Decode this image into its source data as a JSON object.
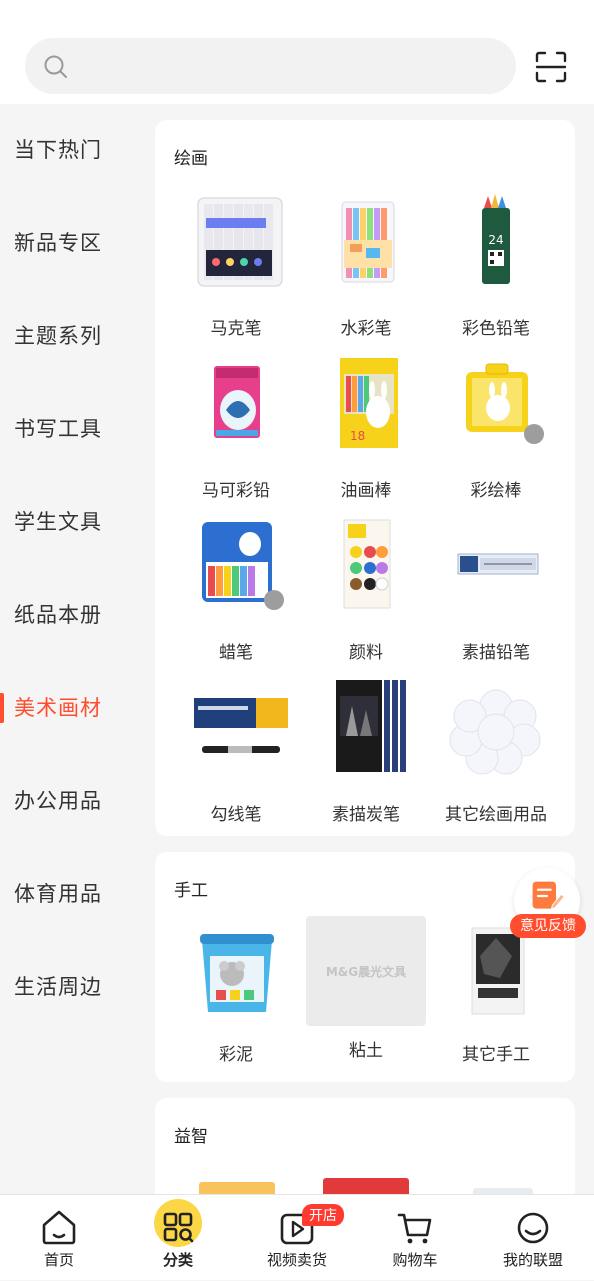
{
  "search": {
    "placeholder": ""
  },
  "sidebar": {
    "items": [
      {
        "label": "当下热门"
      },
      {
        "label": "新品专区"
      },
      {
        "label": "主题系列"
      },
      {
        "label": "书写工具"
      },
      {
        "label": "学生文具"
      },
      {
        "label": "纸品本册"
      },
      {
        "label": "美术画材"
      },
      {
        "label": "办公用品"
      },
      {
        "label": "体育用品"
      },
      {
        "label": "生活周边"
      }
    ],
    "active": "美术画材"
  },
  "sections": [
    {
      "title": "绘画",
      "products": [
        {
          "label": "马克笔"
        },
        {
          "label": "水彩笔"
        },
        {
          "label": "彩色铅笔"
        },
        {
          "label": "马可彩铅"
        },
        {
          "label": "油画棒"
        },
        {
          "label": "彩绘棒"
        },
        {
          "label": "蜡笔"
        },
        {
          "label": "颜料"
        },
        {
          "label": "素描铅笔"
        },
        {
          "label": "勾线笔"
        },
        {
          "label": "素描炭笔"
        },
        {
          "label": "其它绘画用品"
        }
      ]
    },
    {
      "title": "手工",
      "products": [
        {
          "label": "彩泥"
        },
        {
          "label": "粘土",
          "placeholder_logo": "M&G晨光文具"
        },
        {
          "label": "其它手工"
        }
      ]
    },
    {
      "title": "益智",
      "products": []
    }
  ],
  "feedback": {
    "label": "意见反馈"
  },
  "tabbar": {
    "items": [
      {
        "label": "首页",
        "icon": "home-icon"
      },
      {
        "label": "分类",
        "icon": "category-icon"
      },
      {
        "label": "视频卖货",
        "icon": "video-icon",
        "badge": "开店"
      },
      {
        "label": "购物车",
        "icon": "cart-icon"
      },
      {
        "label": "我的联盟",
        "icon": "profile-icon"
      }
    ],
    "active": "分类"
  },
  "colors": {
    "accent": "#ff4d2d",
    "badge": "#ff3b30",
    "active_tab_bg": "#fbd745"
  }
}
